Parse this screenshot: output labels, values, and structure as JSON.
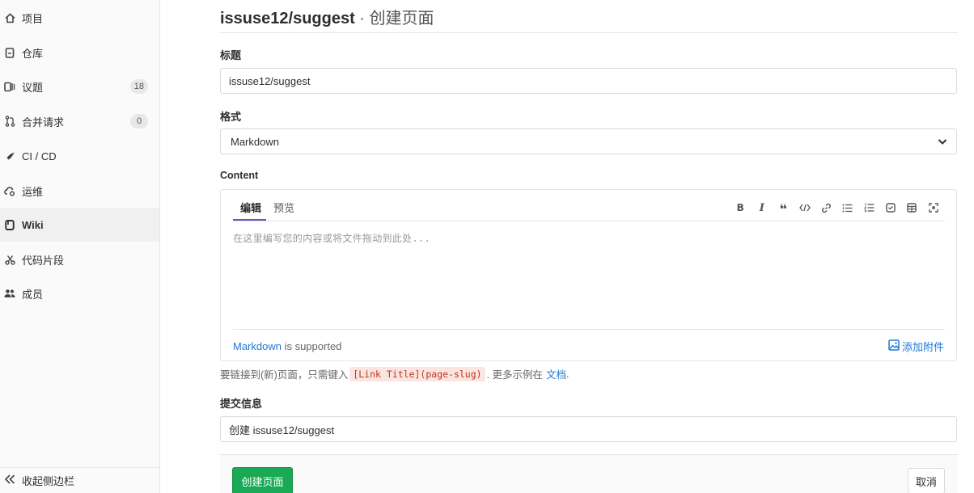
{
  "sidebar": {
    "items": [
      {
        "label": "项目",
        "icon": "home-icon"
      },
      {
        "label": "仓库",
        "icon": "doc-icon"
      },
      {
        "label": "议题",
        "icon": "issues-icon",
        "badge": "18"
      },
      {
        "label": "合并请求",
        "icon": "merge-request-icon",
        "badge": "0"
      },
      {
        "label": "CI / CD",
        "icon": "rocket-icon"
      },
      {
        "label": "运维",
        "icon": "cloud-gear-icon"
      },
      {
        "label": "Wiki",
        "icon": "book-icon",
        "active": true
      },
      {
        "label": "代码片段",
        "icon": "scissors-icon"
      },
      {
        "label": "成员",
        "icon": "users-icon"
      }
    ],
    "collapse_label": "收起侧边栏"
  },
  "page": {
    "repo": "issuse12/suggest",
    "separator": " · ",
    "action": "创建页面"
  },
  "form": {
    "title_label": "标题",
    "title_value": "issuse12/suggest",
    "format_label": "格式",
    "format_value": "Markdown",
    "content_label": "Content",
    "tab_edit": "编辑",
    "tab_preview": "预览",
    "content_placeholder": "在这里编写您的内容或将文件拖动到此处...",
    "markdown_link": "Markdown",
    "markdown_supported": " is supported",
    "attach_label": "添加附件",
    "help_prefix": "要链接到(新)页面，只需键入",
    "help_code": "[Link Title](page-slug)",
    "help_suffix": ". 更多示例在",
    "help_link": "文档",
    "help_end": ".",
    "commit_label": "提交信息",
    "commit_value": "创建 issuse12/suggest"
  },
  "actions": {
    "create_label": "创建页面",
    "cancel_label": "取消"
  },
  "colors": {
    "accent": "#6b4fbb",
    "link": "#1f78d1",
    "create_button": "#1aaa55"
  }
}
